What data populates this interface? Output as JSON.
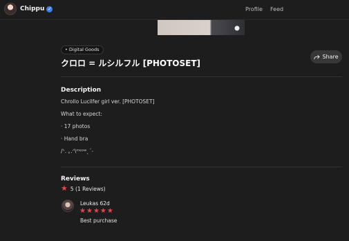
{
  "nav": {
    "brand_name": "Chippu",
    "verified_icon": "check-icon",
    "links": [
      "Profile",
      "Feed"
    ]
  },
  "product": {
    "badge": "• Digital Goods",
    "title": "クロロ = ルシルフル [PHOTOSET]",
    "share_label": "Share"
  },
  "description": {
    "heading": "Description",
    "lines": [
      "Chrollo Lucilfer girl ver. [PHOTOSET]",
      "What to expect:",
      "· 17 photos",
      "· Hand bra",
      "/ᐠ. ｡.ᐟ\\ᵐᵉᵒʷˎˊ˗"
    ]
  },
  "reviews": {
    "heading": "Reviews",
    "summary": "5 (1 Reviews)",
    "items": [
      {
        "author": "Leukas 62d",
        "rating": 5,
        "text": "Best purchase"
      }
    ]
  },
  "colors": {
    "background": "#1e1d1d",
    "star": "#e5484d",
    "verified": "#3b82f6",
    "share_bg": "#383737"
  }
}
